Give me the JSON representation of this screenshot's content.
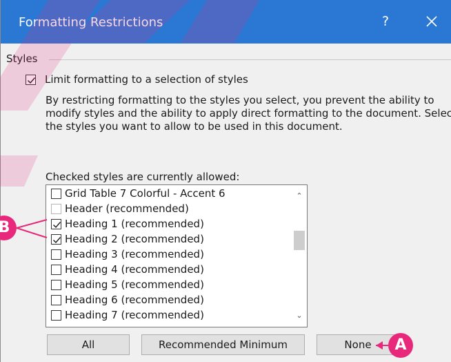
{
  "dialog": {
    "title": "Formatting Restrictions",
    "help_label": "?",
    "group_label": "Styles",
    "limit_checkbox": {
      "label": "Limit formatting to a selection of styles",
      "checked": true
    },
    "description": "By restricting formatting to the styles you select, you prevent the ability to modify styles and the ability to apply direct formatting to the document. Select the styles you want to allow to be used in this document.",
    "checked_styles_label": "Checked styles are currently allowed:",
    "styles_list": [
      {
        "label": "Grid Table 7 Colorful - Accent 6",
        "checked": false,
        "disabled": false
      },
      {
        "label": "Header (recommended)",
        "checked": false,
        "disabled": true
      },
      {
        "label": "Heading 1 (recommended)",
        "checked": true,
        "disabled": false
      },
      {
        "label": "Heading 2 (recommended)",
        "checked": true,
        "disabled": false
      },
      {
        "label": "Heading 3 (recommended)",
        "checked": false,
        "disabled": false
      },
      {
        "label": "Heading 4 (recommended)",
        "checked": false,
        "disabled": false
      },
      {
        "label": "Heading 5 (recommended)",
        "checked": false,
        "disabled": false
      },
      {
        "label": "Heading 6 (recommended)",
        "checked": false,
        "disabled": false
      },
      {
        "label": "Heading 7 (recommended)",
        "checked": false,
        "disabled": false
      }
    ],
    "buttons": {
      "all": "All",
      "recommended": "Recommended Minimum",
      "none": "None"
    }
  },
  "callouts": {
    "a": "A",
    "b": "B"
  },
  "colors": {
    "titlebar": "#2b78d4",
    "callout": "#e8287a",
    "watermark": "#e8287a"
  }
}
